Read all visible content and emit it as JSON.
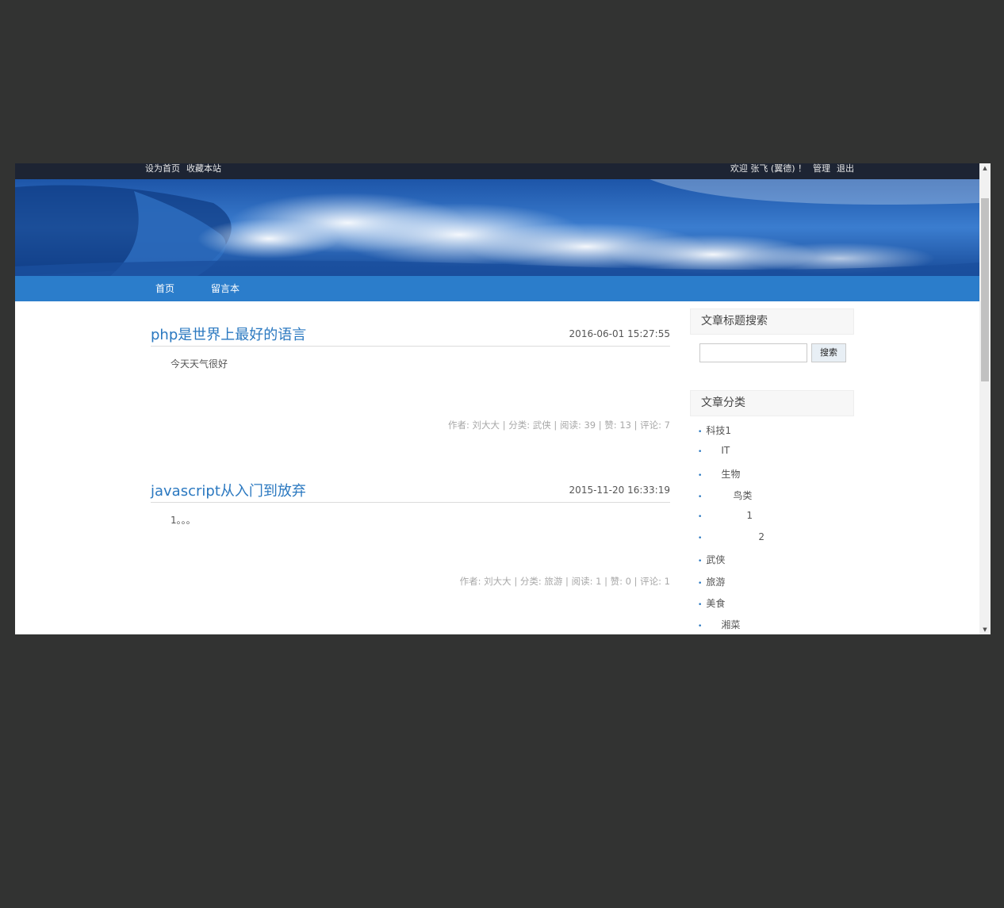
{
  "topbar": {
    "set_home": "设为首页",
    "bookmark": "收藏本站",
    "welcome": "欢迎 张飞 (翼德) ！",
    "admin": "管理",
    "logout": "退出"
  },
  "nav": {
    "home": "首页",
    "guestbook": "留言本"
  },
  "posts": [
    {
      "title": "php是世界上最好的语言",
      "date": "2016-06-01 15:27:55",
      "body": "今天天气很好",
      "meta": "作者: 刘大大 | 分类: 武侠 | 阅读: 39 | 赞: 13 | 评论: 7"
    },
    {
      "title": "javascript从入门到放弃",
      "date": "2015-11-20 16:33:19",
      "body": "1。。。",
      "meta": "作者: 刘大大 | 分类: 旅游 | 阅读: 1 | 赞: 0 | 评论: 1"
    }
  ],
  "sidebar": {
    "search_title": "文章标题搜索",
    "search_button": "搜索",
    "search_value": "",
    "category_title": "文章分类",
    "categories": [
      "科技1",
      "IT",
      "生物",
      "鸟类",
      "1",
      "2",
      "武侠",
      "旅游",
      "美食",
      "湘菜"
    ]
  },
  "colors": {
    "accent": "#2b7dcb",
    "link": "#2a78c0",
    "background": "#323332"
  }
}
